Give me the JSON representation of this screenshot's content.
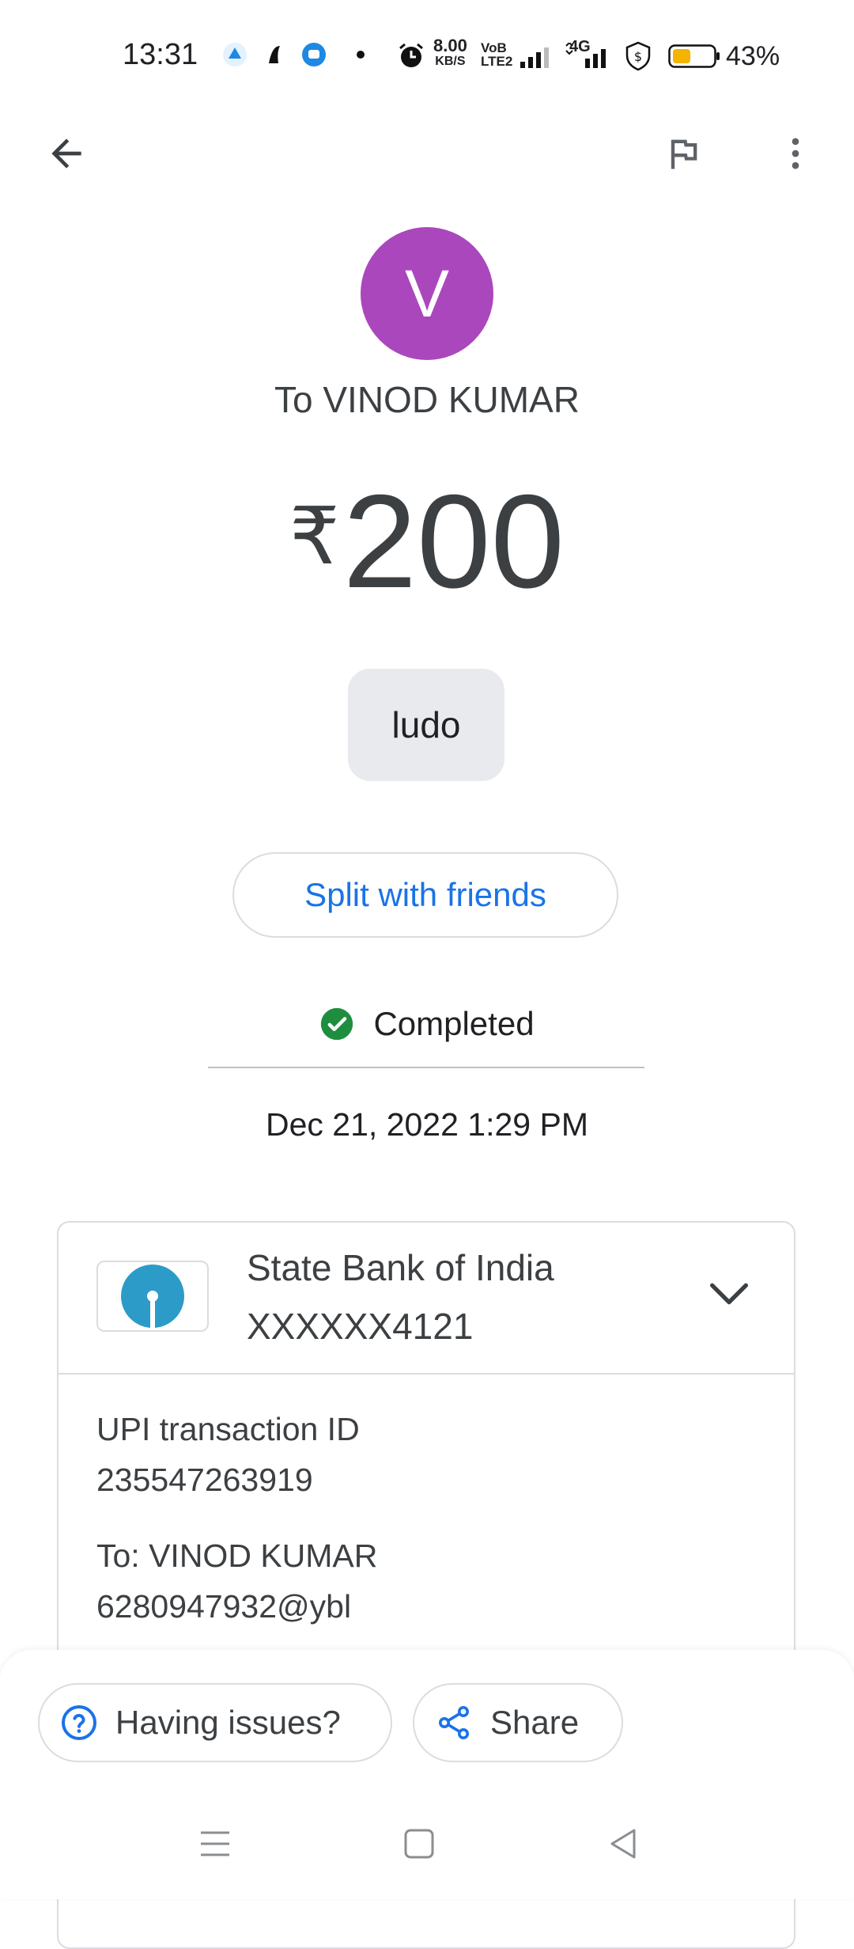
{
  "status_bar": {
    "time": "13:31",
    "net_speed_value": "8.00",
    "net_speed_unit": "KB/S",
    "volte_top": "VoB",
    "volte_bottom": "LTE2",
    "network": "4G",
    "battery_percent": "43%"
  },
  "header": {
    "back_icon": "arrow-back-icon",
    "flag_icon": "flag-icon",
    "menu_icon": "more-vert-icon"
  },
  "recipient": {
    "initial": "V",
    "avatar_color": "#ab47bc",
    "title": "To VINOD KUMAR"
  },
  "amount": {
    "currency": "₹",
    "value": "200"
  },
  "note": "ludo",
  "split_button": "Split with friends",
  "status": {
    "text": "Completed",
    "color": "#1e8e3e"
  },
  "datetime": "Dec 21, 2022 1:29 PM",
  "bank": {
    "name": "State Bank of India",
    "account": "XXXXXX4121",
    "logo_color": "#2d9bc7"
  },
  "details": {
    "upi_label": "UPI transaction ID",
    "upi_id": "235547263919",
    "to_label": "To: VINOD KUMAR",
    "to_vpa": "6280947932@ybl"
  },
  "bottom_actions": {
    "issues_label": "Having issues?",
    "share_label": "Share",
    "accent": "#1a73e8"
  },
  "nav": {
    "menu_icon": "recents-icon",
    "home_icon": "home-icon",
    "back_icon": "back-triangle-icon"
  }
}
